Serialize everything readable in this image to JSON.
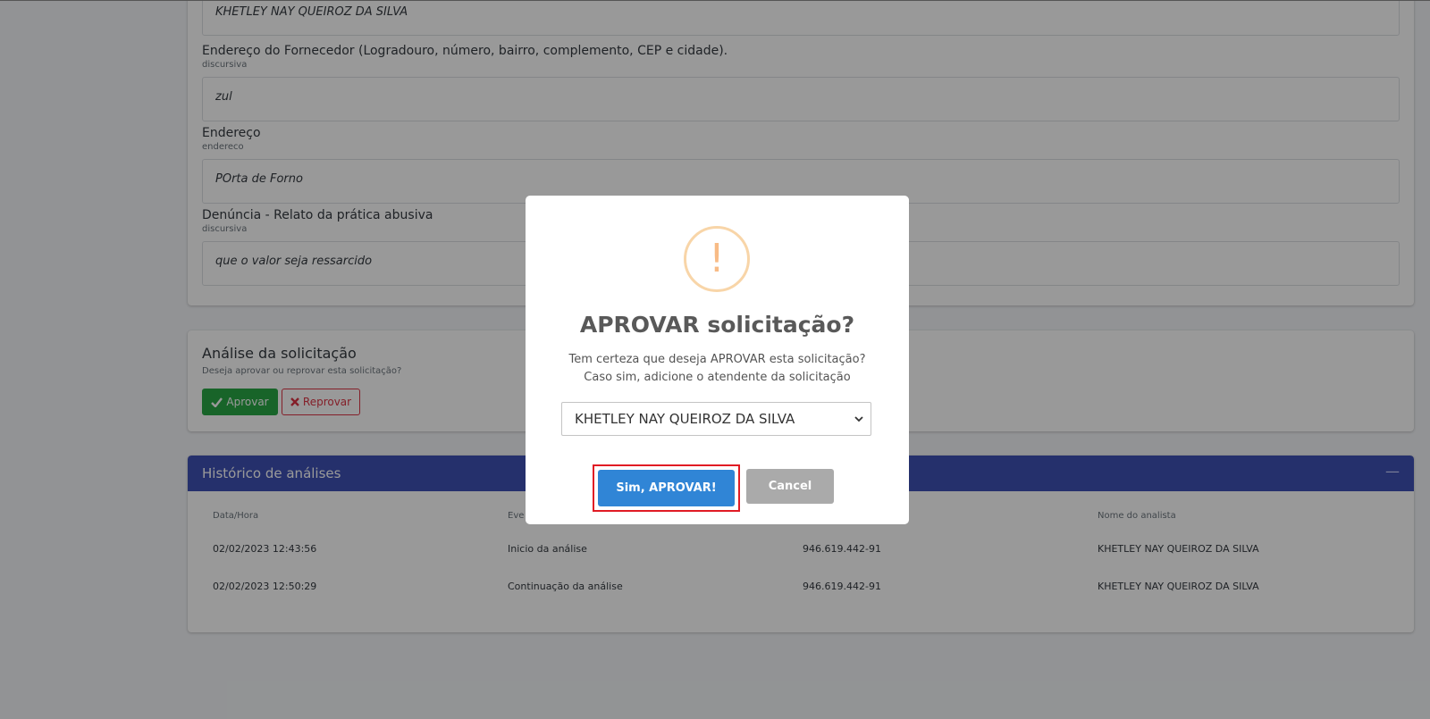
{
  "fields": [
    {
      "label": "",
      "sub": "",
      "value": "KHETLEY NAY QUEIROZ DA SILVA"
    },
    {
      "label": "Endereço do Fornecedor (Logradouro, número, bairro, complemento, CEP e cidade).",
      "sub": "discursiva",
      "value": "zul"
    },
    {
      "label": "Endereço",
      "sub": "endereco",
      "value": "POrta de Forno"
    },
    {
      "label": "Denúncia - Relato da prática abusiva",
      "sub": "discursiva",
      "value": "que o valor seja ressarcido"
    }
  ],
  "analysis": {
    "title": "Análise da solicitação",
    "subtitle": "Deseja aprovar ou reprovar esta solicitação?",
    "approve_label": "Aprovar",
    "reject_label": "Reprovar"
  },
  "history": {
    "title": "Histórico de análises",
    "columns": [
      "Data/Hora",
      "Eve",
      "",
      "Nome do analista"
    ],
    "rows": [
      [
        "02/02/2023 12:43:56",
        "Inicio da análise",
        "946.619.442-91",
        "KHETLEY NAY QUEIROZ DA SILVA"
      ],
      [
        "02/02/2023 12:50:29",
        "Continuação da análise",
        "946.619.442-91",
        "KHETLEY NAY QUEIROZ DA SILVA"
      ]
    ]
  },
  "modal": {
    "title": "APROVAR solicitação?",
    "line1": "Tem certeza que deseja APROVAR esta solicitação?",
    "line2": "Caso sim, adicione o atendente da solicitação",
    "selected": "KHETLEY NAY QUEIROZ DA SILVA",
    "confirm_label": "Sim, APROVAR!",
    "cancel_label": "Cancel"
  },
  "colors": {
    "approve": "#28a745",
    "reject": "#dc3545",
    "header": "#3f51b5",
    "confirm": "#3085d6",
    "cancel": "#aaaaaa",
    "warning": "#f8bb86",
    "highlight": "#e01b24"
  }
}
